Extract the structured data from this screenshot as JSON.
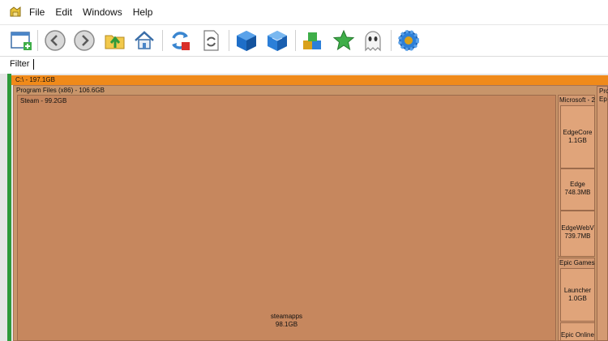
{
  "menu": [
    "File",
    "Edit",
    "Windows",
    "Help"
  ],
  "filter": {
    "label": "Filter",
    "value": ""
  },
  "toolbar": {
    "buttons": [
      "new-window-icon",
      "back-icon",
      "forward-icon",
      "up-folder-icon",
      "home-icon",
      "refresh-stop-icon",
      "refresh-icon",
      "blue-cube-icon",
      "blue-cube-outline-icon",
      "blocks-icon",
      "star-icon",
      "ghost-icon",
      "gear-icon"
    ]
  },
  "treemap": {
    "drive": "C:\\ - 197.1GB",
    "program_files_x86": "Program Files (x86) - 106.6GB",
    "program_files_right": "Pro",
    "right_col2": "Ep",
    "steam": "Steam - 99.2GB",
    "steamapps_name": "steamapps",
    "steamapps_size": "98.1GB",
    "microsoft": "Microsoft - 2",
    "edgecore_name": "EdgeCore",
    "edgecore_size": "1.1GB",
    "edge_name": "Edge",
    "edge_size": "748.3MB",
    "edgewebview_name": "EdgeWebV",
    "edgewebview_size": "739.7MB",
    "epic_games": "Epic Games",
    "launcher_name": "Launcher",
    "launcher_size": "1.0GB",
    "epic_online": "Epic Online"
  },
  "colors": {
    "drive_bar": "#f08a1a",
    "folder": "#c6875e",
    "accent_green": "#2e9a3a"
  }
}
